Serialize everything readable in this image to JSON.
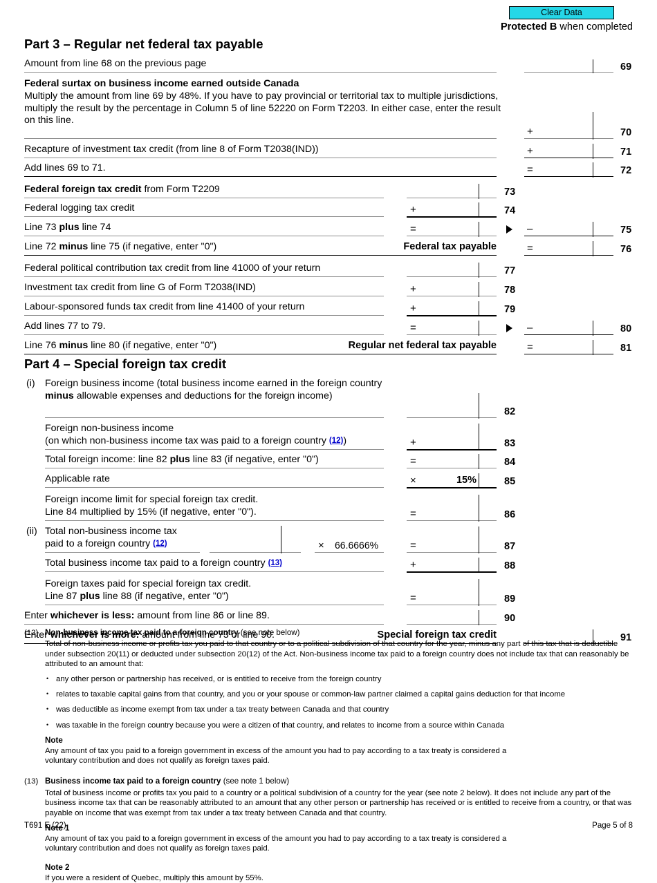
{
  "header": {
    "clear_data_label": "Clear Data",
    "protected_bold": "Protected B",
    "protected_rest": " when completed",
    "accent_color": "#25d7e8"
  },
  "part3": {
    "title_bold": "Part 3",
    "title_dash": " – ",
    "title_rest": "Regular net federal tax payable",
    "rows": [
      {
        "label": "Amount from line 68 on the previous page",
        "line": "69"
      },
      {
        "label_bold": "Federal surtax on business income earned outside Canada",
        "label": "Multiply the amount from line 69 by 48%. If you have to pay provincial or territorial tax to multiple jurisdictions, multiply the result by the percentage in Column 5 of line 52220 on Form T2203. In either case, enter the result on this line.",
        "op": "+",
        "line": "70"
      },
      {
        "label": "Recapture of investment tax credit (from line 8 of Form T2038(IND))",
        "op": "+",
        "line": "71"
      },
      {
        "label": "Add lines 69 to 71.",
        "op": "=",
        "line": "72"
      },
      {
        "label_bold": "Federal foreign tax credit",
        "label_rest": " from Form T2209",
        "line": "73"
      },
      {
        "label": "Federal logging tax credit",
        "op": "+",
        "line": "74"
      },
      {
        "label": "Line 73 plus line 74",
        "op": "=",
        "op_outer": "–",
        "line": "75"
      },
      {
        "label": "Line 72 minus line 75 (if negative, enter \"0\")",
        "caption": "Federal tax payable",
        "op_outer": "=",
        "line": "76"
      },
      {
        "label": "Federal political contribution tax credit from line 41000 of your return",
        "line": "77"
      },
      {
        "label": "Investment tax credit from line G of Form T2038(IND)",
        "op": "+",
        "line": "78"
      },
      {
        "label": "Labour-sponsored funds tax credit from line 41400 of your return",
        "op": "+",
        "line": "79"
      },
      {
        "label": "Add lines 77 to 79.",
        "op": "=",
        "op_outer": "–",
        "line": "80"
      },
      {
        "label": "Line 76 minus line 80 (if negative, enter \"0\")",
        "caption": "Regular net federal tax payable",
        "op_outer": "=",
        "line": "81"
      }
    ]
  },
  "part4": {
    "title_bold": "Part 4",
    "title_dash": " – ",
    "title_rest": "Special foreign tax credit",
    "roman_i": "(i)",
    "roman_ii": "(ii)",
    "rows": [
      {
        "label": "Foreign business income (total business income earned in the foreign country minus allowable expenses and deductions for the foreign income)",
        "line": "82"
      },
      {
        "label": "Foreign non-business income (on which non-business income tax was paid to a foreign country (12))",
        "op": "+",
        "line": "83"
      },
      {
        "label": "Total foreign income: line 82 plus line 83 (if negative, enter \"0\")",
        "op": "=",
        "line": "84"
      },
      {
        "label": "Applicable rate",
        "op": "×",
        "value": "15%",
        "line": "85"
      },
      {
        "label": "Foreign income limit for special foreign tax credit. Line 84 multiplied by 15% (if negative, enter \"0\").",
        "op": "=",
        "line": "86"
      },
      {
        "label": "Total non-business income tax paid to a foreign country (12)",
        "mult_op": "×",
        "mult_value": "66.6666%",
        "op": "=",
        "line": "87"
      },
      {
        "label": "Total business income tax paid to a foreign country (13)",
        "op": "+",
        "line": "88"
      },
      {
        "label": "Foreign taxes paid for special foreign tax credit. Line 87 plus line 88 (if negative, enter \"0\")",
        "op": "=",
        "line": "89"
      },
      {
        "label": "Enter whichever is less: amount from line 86 or line 89.",
        "line": "90"
      },
      {
        "label": "Enter whichever is more: amount from line 73 or line 90.",
        "caption": "Special foreign tax credit",
        "line": "91"
      }
    ]
  },
  "footnotes": [
    {
      "tag": "(12)",
      "head_bold": "Non-business income tax paid to a foreign country",
      "head_reg": " (see note below)",
      "body": "Total of non-business income or profits tax you paid to that country or to a political subdivision of that country for the year, minus any part of this tax that is deductible under subsection 20(11) or deducted under subsection 20(12) of the Act. Non-business income tax paid to a foreign country does not include tax that can reasonably be attributed to an amount that:",
      "bullets": [
        "any other person or partnership has received, or is entitled to receive from the foreign country",
        "relates to taxable capital gains from that country, and you or your spouse or common-law partner claimed a capital gains deduction for that income",
        "was deductible as income exempt from tax under a tax treaty between Canada and that country",
        "was taxable in the foreign country because you were a citizen of that country, and relates to income from a source within Canada"
      ],
      "notes": [
        {
          "heading": "Note",
          "text": "Any amount of tax you paid to a foreign government in excess of the amount you had to pay according to a tax treaty is considered a voluntary contribution and does not qualify as foreign taxes paid."
        }
      ]
    },
    {
      "tag": "(13)",
      "head_bold": "Business income tax paid to a foreign country",
      "head_reg": " (see note 1 below)",
      "body": "Total of business income or profits tax you paid to a country or a political subdivision of a country for the year (see note 2 below). It does not include any part of the business income tax that can be reasonably attributed to an amount that any other person or partnership has received or is entitled to receive from a country, or that was payable on income that was exempt from tax under a tax treaty between Canada and that country.",
      "bullets": [],
      "notes": [
        {
          "heading": "Note 1",
          "text": "Any amount of tax you paid to a foreign government in excess of the amount you had to pay according to a tax treaty is considered a voluntary contribution and does not qualify as foreign taxes paid."
        },
        {
          "heading": "Note 2",
          "text": "If you were a resident of Quebec, multiply this amount by 55%."
        }
      ]
    }
  ],
  "footer": {
    "form_id": "T691 E (22)",
    "page_label": "Page 5 of 8"
  }
}
